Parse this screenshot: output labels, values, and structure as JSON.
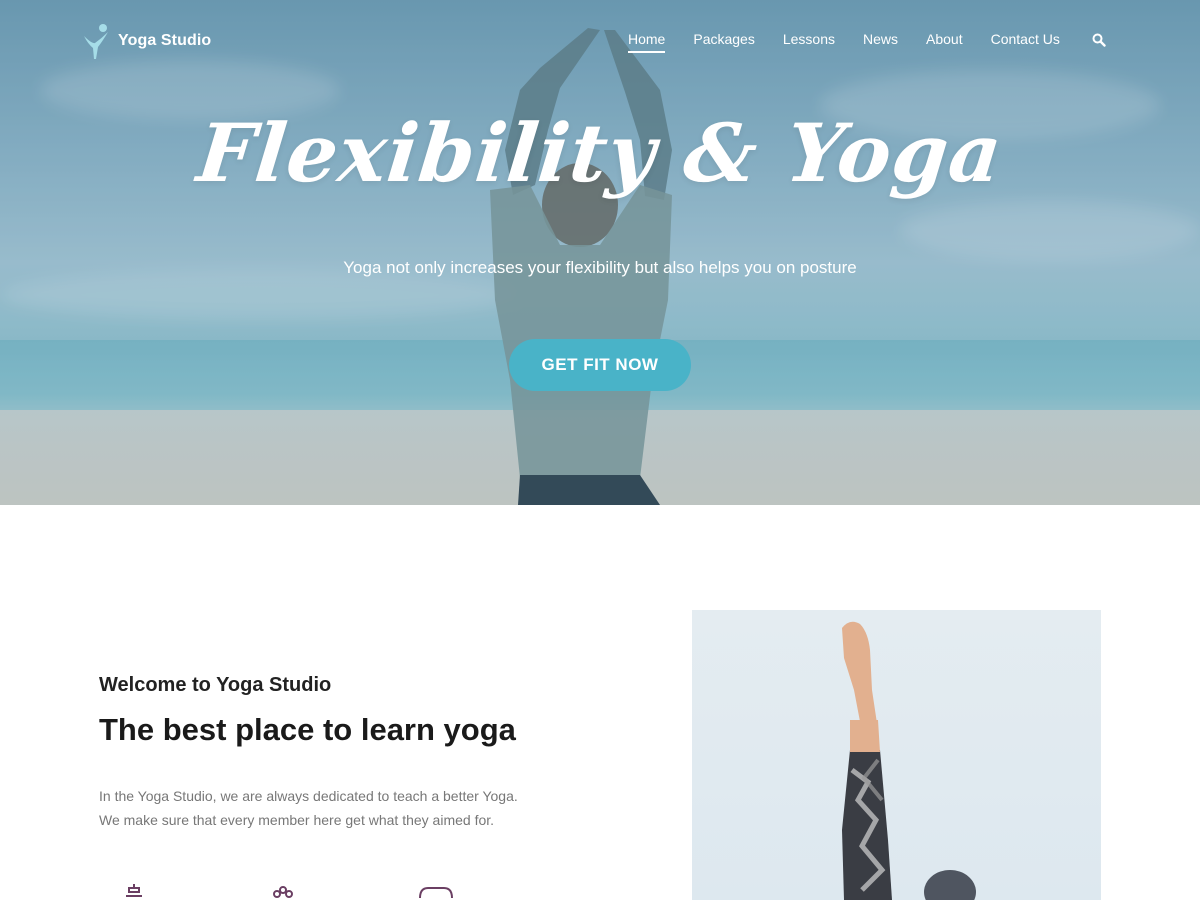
{
  "brand": {
    "name": "Yoga Studio"
  },
  "nav": {
    "items": [
      {
        "label": "Home",
        "active": true
      },
      {
        "label": "Packages",
        "active": false
      },
      {
        "label": "Lessons",
        "active": false
      },
      {
        "label": "News",
        "active": false
      },
      {
        "label": "About",
        "active": false
      },
      {
        "label": "Contact Us",
        "active": false
      }
    ],
    "search_icon": "search-icon"
  },
  "hero": {
    "title": "Flexibility & Yoga",
    "subtitle": "Yoga not only increases your flexibility but also helps you on posture",
    "cta_label": "GET FIT NOW"
  },
  "about": {
    "welcome": "Welcome to Yoga Studio",
    "heading": "The best place to learn yoga",
    "description": [
      "In the Yoga Studio, we are always dedicated to teach a better Yoga.",
      "We make sure that every member  here get what they aimed for."
    ]
  },
  "colors": {
    "accent": "#49b3c8",
    "icon_purple": "#6b3f63"
  }
}
